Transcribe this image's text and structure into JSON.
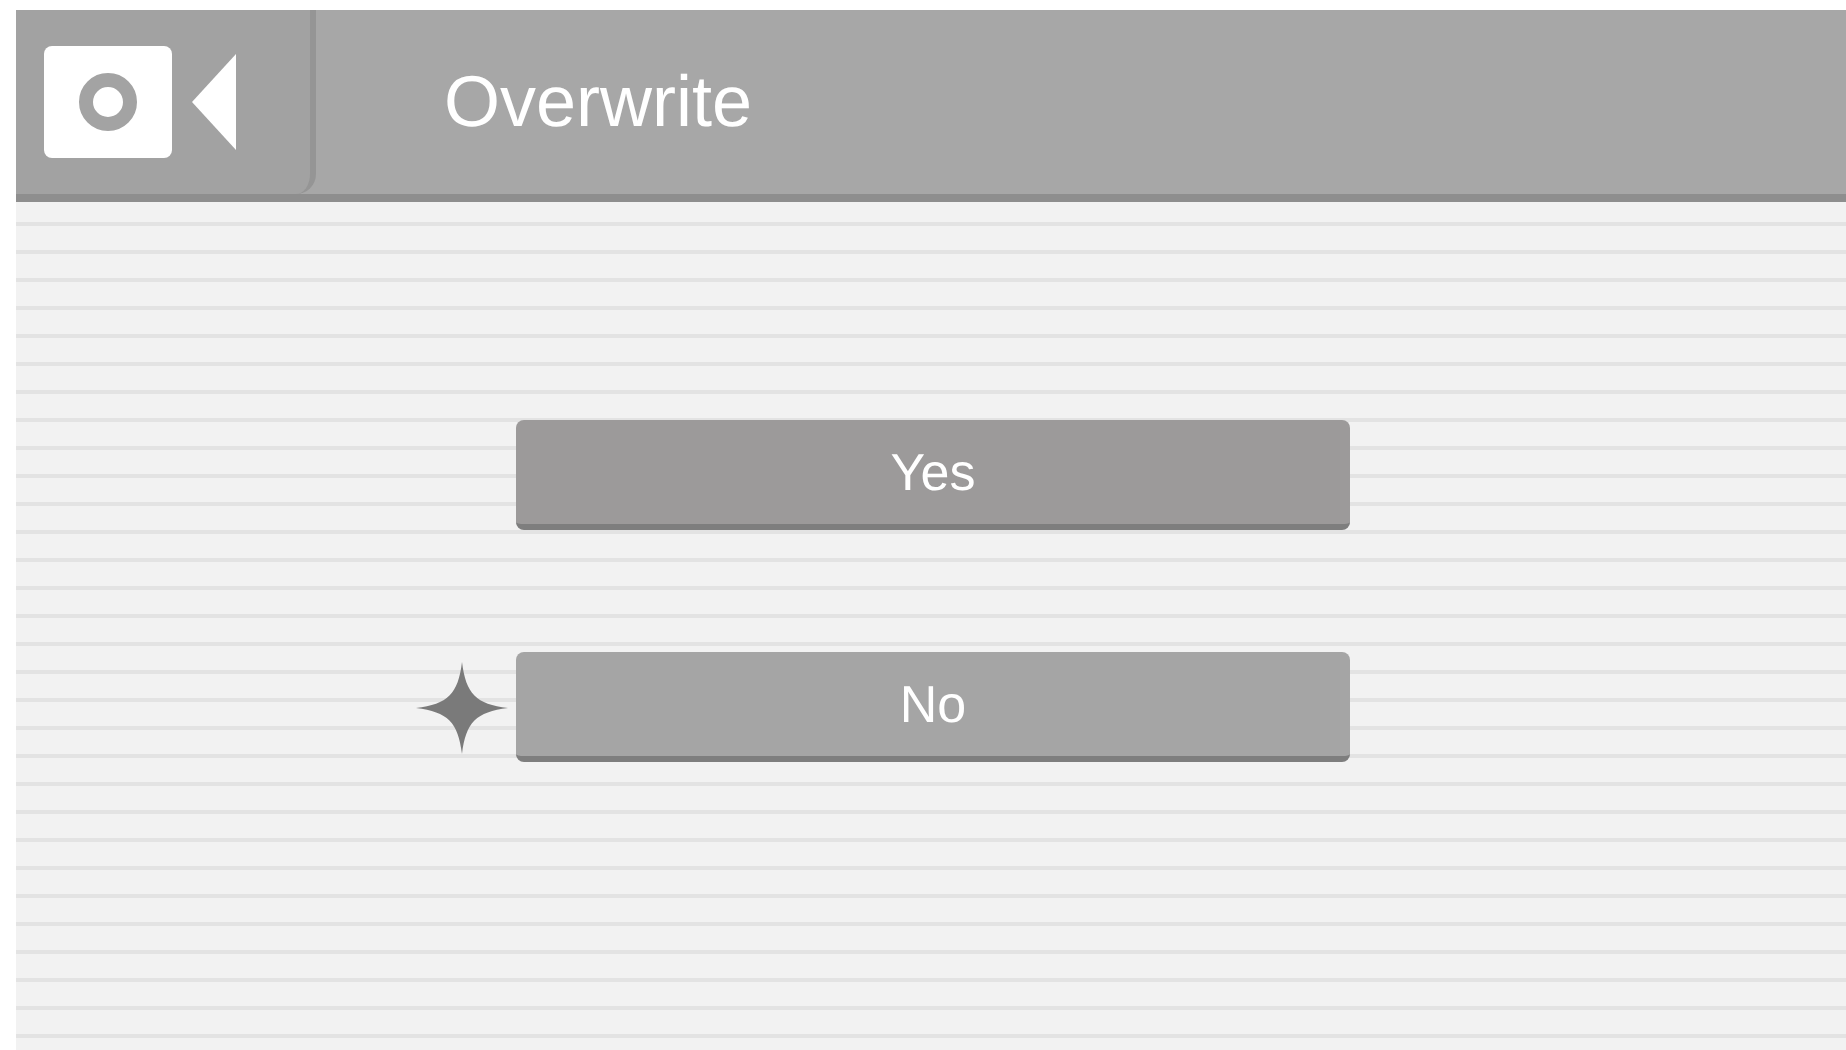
{
  "header": {
    "title": "Overwrite"
  },
  "options": [
    {
      "label": "Yes",
      "selected": false
    },
    {
      "label": "No",
      "selected": true
    }
  ]
}
